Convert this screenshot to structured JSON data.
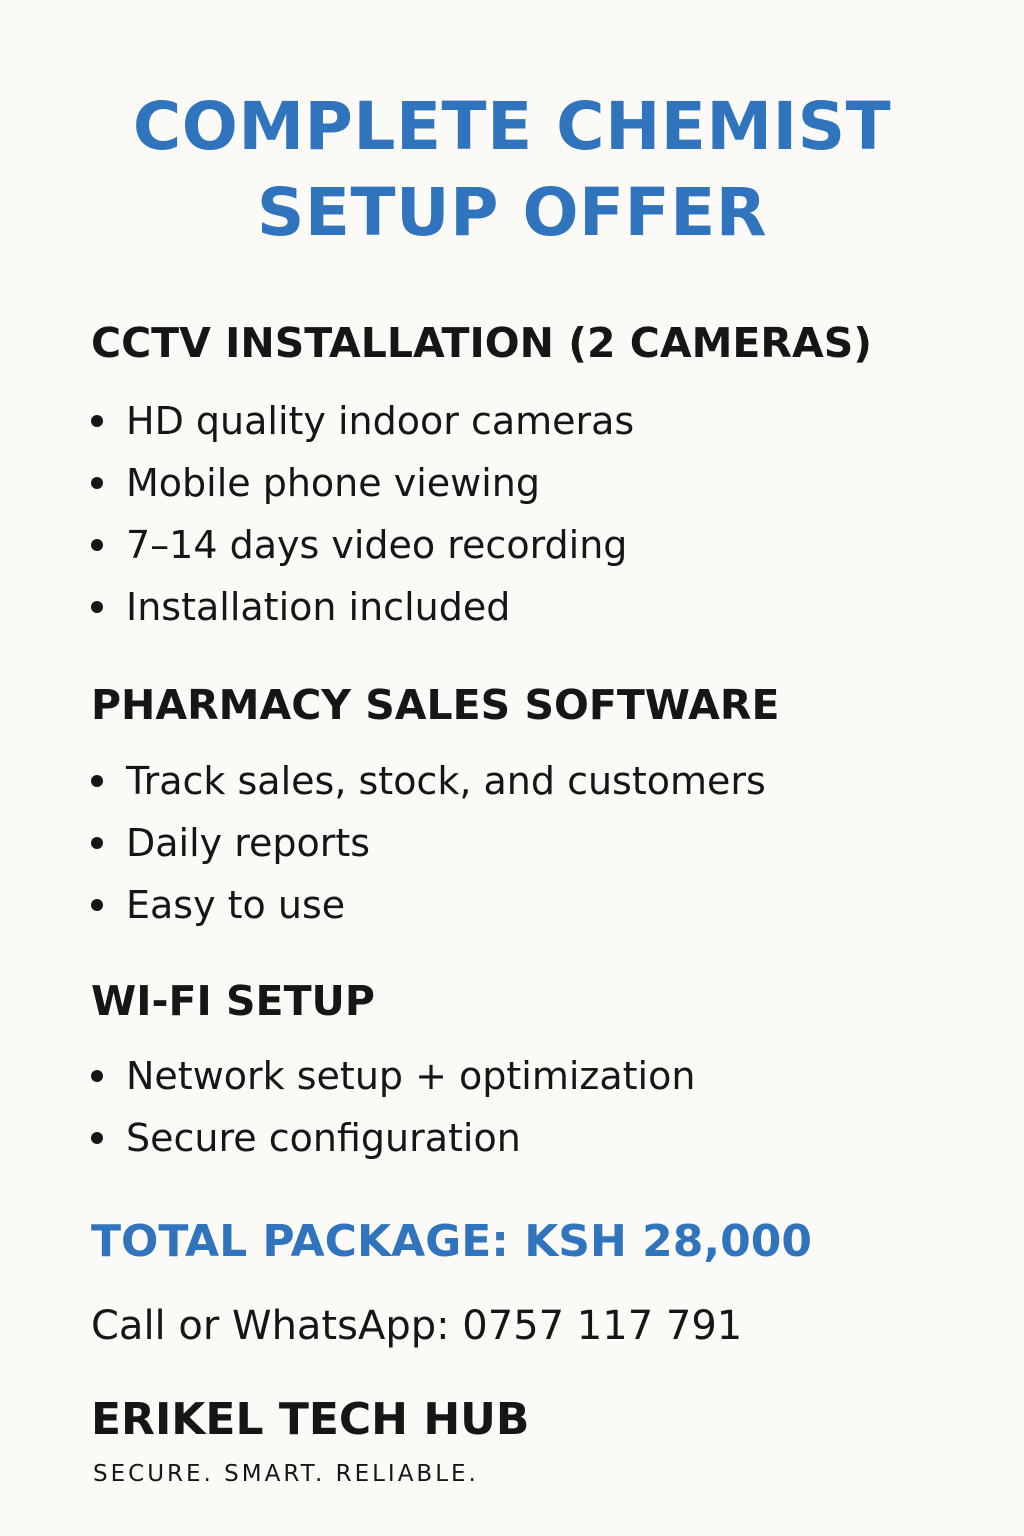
{
  "title": {
    "line1": "COMPLETE CHEMIST",
    "line2": "SETUP OFFER"
  },
  "sections": [
    {
      "heading": "CCTV INSTALLATION (2 CAMERAS)",
      "items": [
        "HD quality indoor cameras",
        "Mobile phone viewing",
        "7–14 days video recording",
        "Installation included"
      ]
    },
    {
      "heading": "PHARMACY SALES SOFTWARE",
      "items": [
        "Track sales, stock, and customers",
        "Daily reports",
        "Easy to use"
      ]
    },
    {
      "heading": "WI-FI SETUP",
      "items": [
        "Network setup + optimization",
        "Secure configuration"
      ]
    }
  ],
  "total": "TOTAL PACKAGE: KSH 28,000",
  "contact": "Call or WhatsApp: 0757 117 791",
  "brand": {
    "name": "ERIKEL TECH HUB",
    "tagline": "SECURE. SMART. RELIABLE."
  },
  "colors": {
    "accent": "#2f74bd",
    "text": "#161616",
    "background": "#fbfaf6"
  }
}
